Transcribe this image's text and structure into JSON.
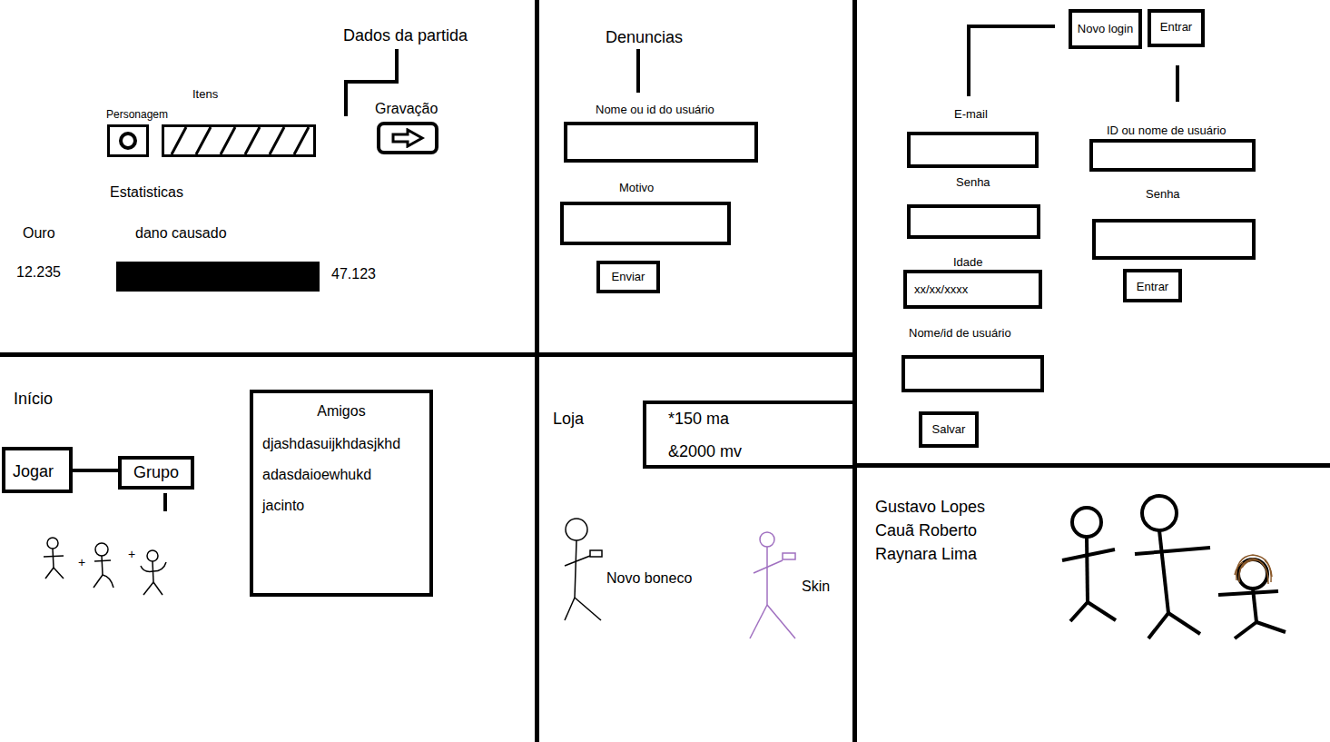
{
  "match_data": {
    "title": "Dados da partida",
    "items_label": "Itens",
    "character_label": "Personagem",
    "recording_label": "Gravação",
    "statistics_label": "Estatisticas",
    "gold_label": "Ouro",
    "gold_value": "12.235",
    "damage_label": "dano causado",
    "damage_level": 1,
    "damage_value": "47.123"
  },
  "reports": {
    "title": "Denuncias",
    "user_label": "Nome ou id do usuário",
    "reason_label": "Motivo",
    "send_button": "Enviar"
  },
  "login": {
    "tabs": [
      {
        "label": "Novo login"
      },
      {
        "label": "Entrar"
      }
    ],
    "register": {
      "email_label": "E-mail",
      "password_label": "Senha",
      "age_label": "Idade",
      "age_value": "xx/xx/xxxx",
      "username_label": "Nome/id de usuário",
      "save_button": "Salvar"
    },
    "sign_in": {
      "user_label": "ID ou nome de usuário",
      "password_label": "Senha",
      "enter_button": "Entrar"
    }
  },
  "home": {
    "title": "Início",
    "play_button": "Jogar",
    "group_button": "Grupo",
    "plus_signs": [
      "+",
      "+"
    ],
    "friends_title": "Amigos",
    "friends": [
      "djashdasuijkhdasjkhd",
      "adasdaioewhukd",
      "jacinto"
    ]
  },
  "shop": {
    "title": "Loja",
    "currencies": [
      "*150 ma",
      "&2000 mv"
    ],
    "products": [
      {
        "label": "Novo boneco",
        "color": "#000000"
      },
      {
        "label": "Skin",
        "color": "#a070c0"
      }
    ]
  },
  "credits": {
    "names": [
      "Gustavo Lopes",
      "Cauã Roberto",
      "Raynara Lima"
    ]
  }
}
